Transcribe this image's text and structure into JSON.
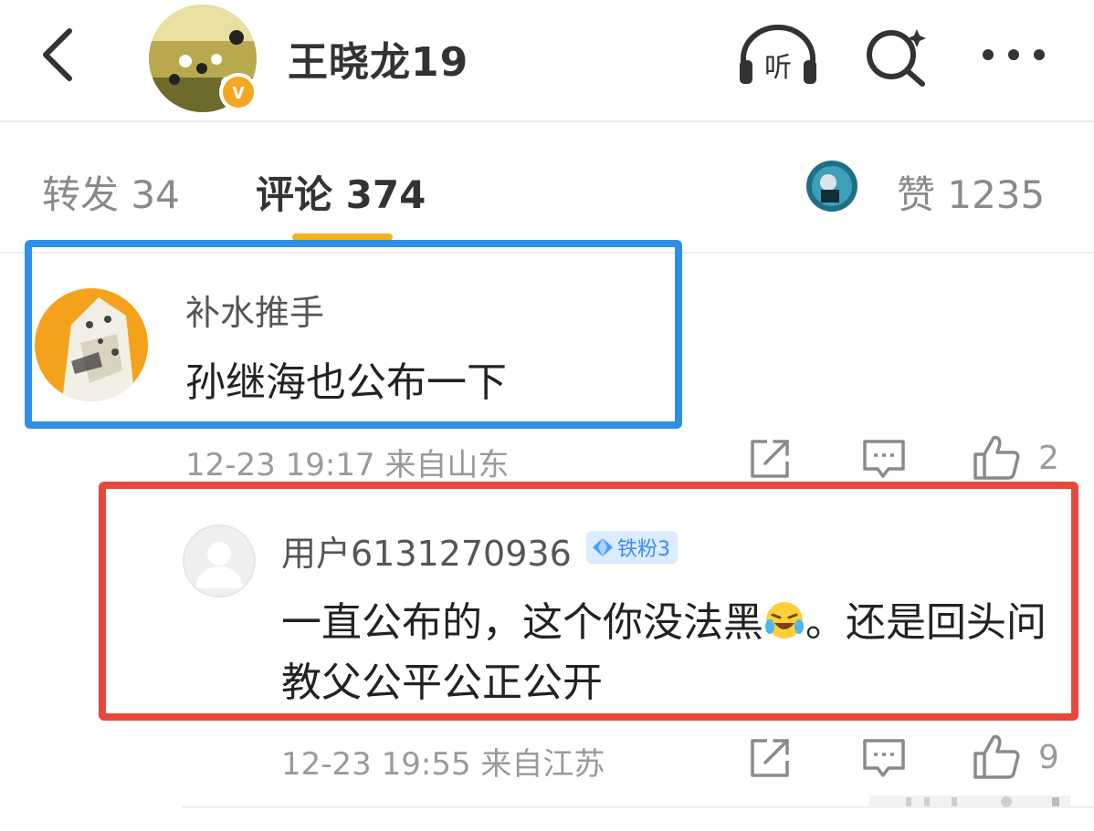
{
  "header": {
    "title": "王晓龙19",
    "icons": [
      "back-icon",
      "listen-icon",
      "search-icon",
      "more-icon"
    ],
    "listen_glyph": "听",
    "verified_mark": "v"
  },
  "tabs": {
    "repost_label": "转发 34",
    "comment_label": "评论 374",
    "likes_label": "赞 1235",
    "active": "评论 374"
  },
  "comments": [
    {
      "user": "补水推手",
      "text": "孙继海也公布一下",
      "meta": "12-23 19:17 来自山东",
      "like_count": "2"
    },
    {
      "user": "用户6131270936",
      "badge": "铁粉3",
      "text_before": "一直公布的，这个你没法黑",
      "text_after": "。还是回头问教父公平公正公开",
      "meta": "12-23 19:55 来自江苏",
      "like_count": "9"
    }
  ],
  "colors": {
    "highlight_blue": "#2f8ee8",
    "highlight_red": "#e8483c",
    "tab_accent": "#f7b21a",
    "verified_orange": "#f5a623",
    "badge_blue": "#3b8bf0"
  }
}
